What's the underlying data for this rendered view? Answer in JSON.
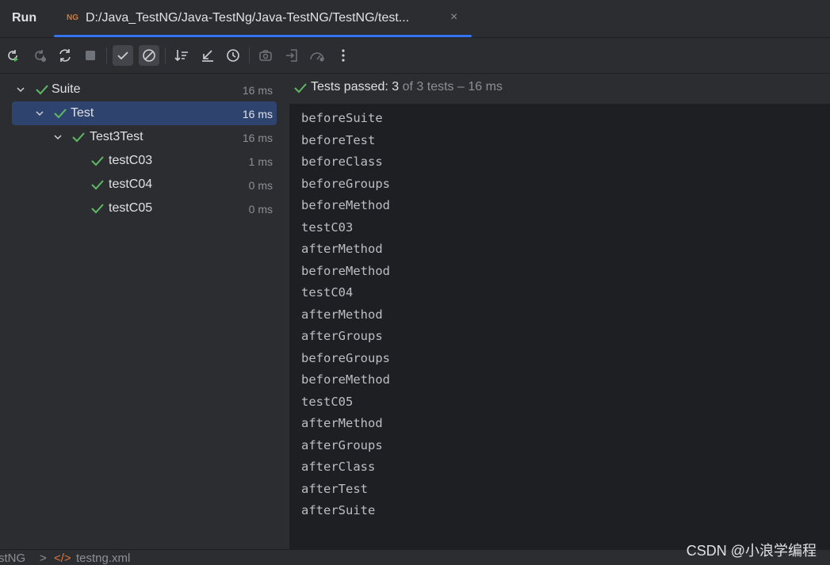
{
  "header": {
    "title": "Run",
    "tab": {
      "icon": "testng-icon",
      "label": "D:/Java_TestNG/Java-TestNg/Java-TestNG/TestNG/test...",
      "close_glyph": "×"
    }
  },
  "toolbar": {
    "buttons": [
      "rerun-icon",
      "rerun-failed-icon",
      "toggle-auto-test-icon",
      "stop-icon",
      "show-passed-icon",
      "show-ignored-icon",
      "sort-icon",
      "collapse-icon",
      "history-icon",
      "screenshot-icon",
      "import-icon",
      "coverage-icon",
      "more-icon"
    ]
  },
  "tree": {
    "items": [
      {
        "label": "Suite",
        "time": "16 ms"
      },
      {
        "label": "Test",
        "time": "16 ms"
      },
      {
        "label": "Test3Test",
        "time": "16 ms"
      },
      {
        "label": "testC03",
        "time": "1 ms"
      },
      {
        "label": "testC04",
        "time": "0 ms"
      },
      {
        "label": "testC05",
        "time": "0 ms"
      }
    ]
  },
  "status": {
    "prefix": "Tests passed: ",
    "passed": "3",
    "suffix": " of 3 tests – 16 ms"
  },
  "console": {
    "lines": [
      "beforeSuite",
      "beforeTest",
      "beforeClass",
      "beforeGroups",
      "beforeMethod",
      "testC03",
      "afterMethod",
      "beforeMethod",
      "testC04",
      "afterMethod",
      "afterGroups",
      "beforeGroups",
      "beforeMethod",
      "testC05",
      "afterMethod",
      "afterGroups",
      "afterClass",
      "afterTest",
      "afterSuite"
    ]
  },
  "bottom": {
    "crumb1": "stNG",
    "crumb_sep": ">",
    "crumb2": "testng.xml"
  },
  "watermark": "CSDN @小浪学编程",
  "colors": {
    "accent": "#3574f0",
    "pass": "#5fb865",
    "selected": "#2e436e"
  }
}
